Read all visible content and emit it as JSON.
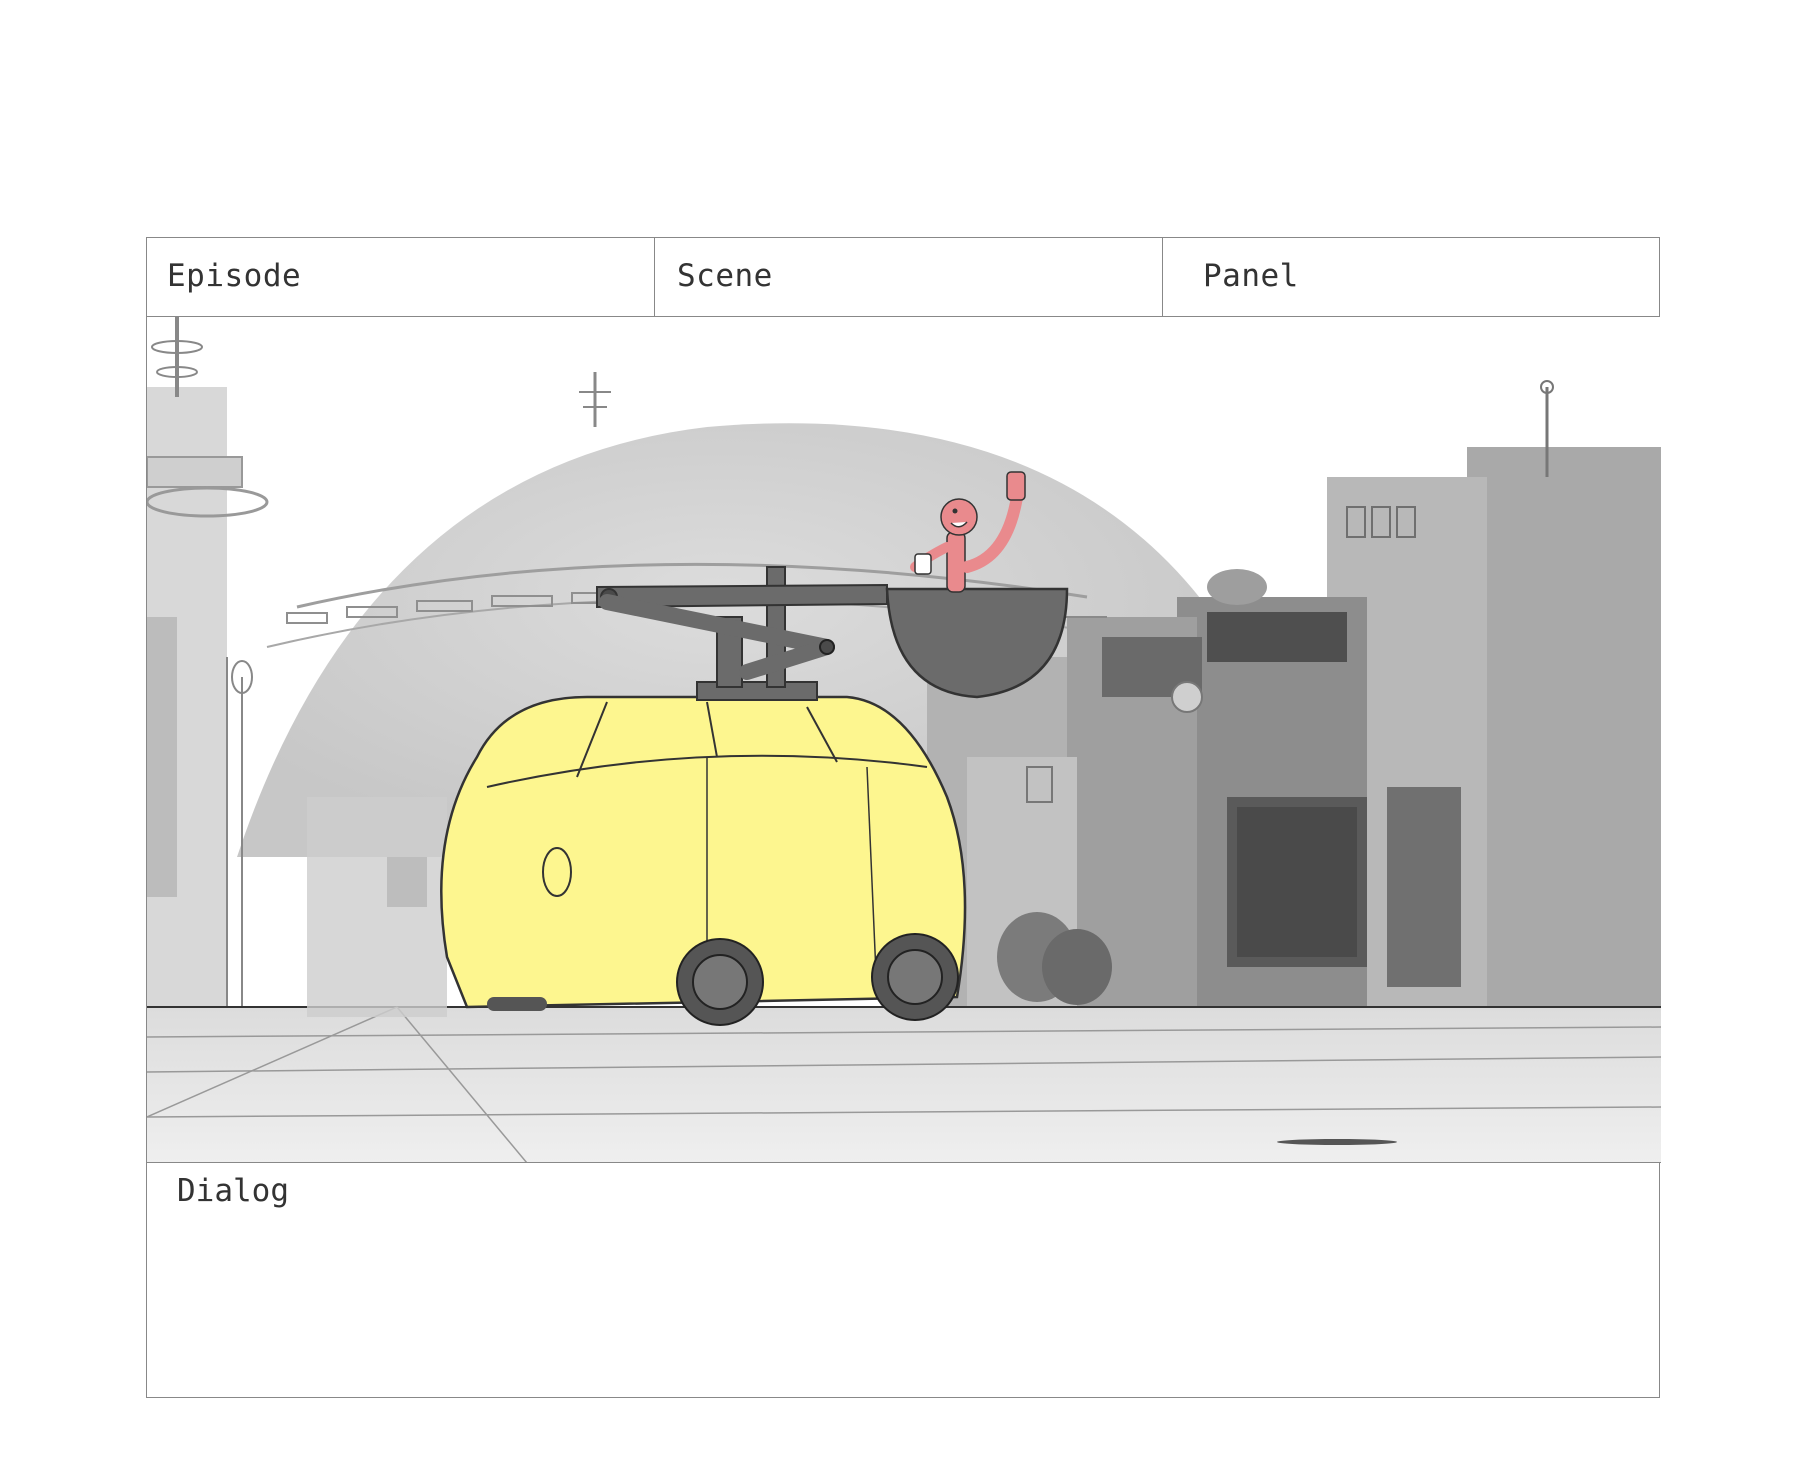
{
  "header": {
    "episode_label": "Episode",
    "scene_label": "Scene",
    "panel_label": "Panel"
  },
  "dialog": {
    "label": "Dialog"
  },
  "colors": {
    "vehicle_body": "#fdf68f",
    "dish_arm": "#6b6b6b",
    "character": "#e98a8d",
    "background_gray": "#c8c8c8"
  }
}
